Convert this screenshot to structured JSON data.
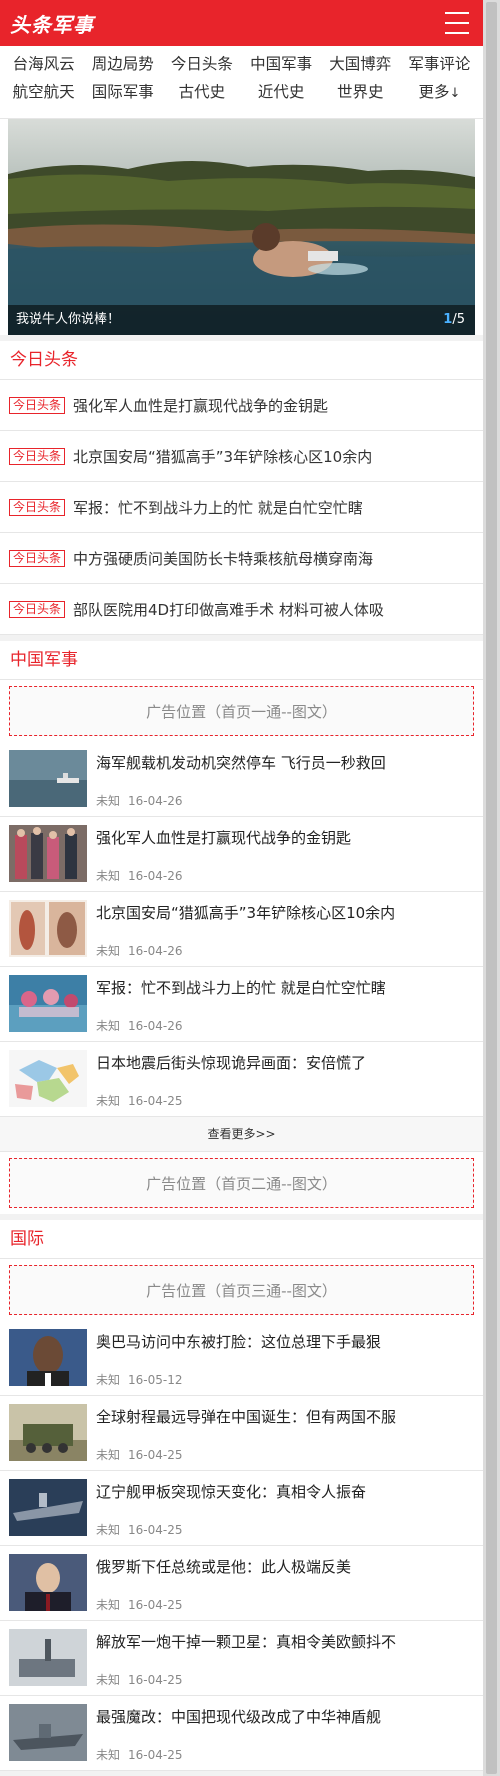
{
  "header": {
    "logo": "头条军事"
  },
  "nav": [
    {
      "label": "台海风云"
    },
    {
      "label": "周边局势"
    },
    {
      "label": "今日头条"
    },
    {
      "label": "中国军事"
    },
    {
      "label": "大国博弈"
    },
    {
      "label": "军事评论"
    },
    {
      "label": "航空航天"
    },
    {
      "label": "国际军事"
    },
    {
      "label": "古代史"
    },
    {
      "label": "近代史"
    },
    {
      "label": "世界史"
    },
    {
      "label": "更多",
      "icon": "down-arrow"
    }
  ],
  "slider": {
    "caption": "我说牛人你说棒！",
    "current": "1",
    "total": "/5"
  },
  "headlines": {
    "title": "今日头条",
    "tag": "今日头条",
    "items": [
      "强化军人血性是打赢现代战争的金钥匙",
      "北京国安局“猎狐高手”3年铲除核心区10余内",
      "军报：忙不到战斗力上的忙 就是白忙空忙瞎",
      "中方强硬质问美国防长卡特乘核航母横穿南海",
      "部队医院用4D打印做高难手术 材料可被人体吸"
    ]
  },
  "china_military": {
    "title": "中国军事",
    "ad_top": "广告位置（首页一通--图文）",
    "items": [
      {
        "title": "海军舰载机发动机突然停车 飞行员一秒救回",
        "source": "未知",
        "date": "16-04-26"
      },
      {
        "title": "强化军人血性是打赢现代战争的金钥匙",
        "source": "未知",
        "date": "16-04-26"
      },
      {
        "title": "北京国安局“猎狐高手”3年铲除核心区10余内",
        "source": "未知",
        "date": "16-04-26"
      },
      {
        "title": "军报：忙不到战斗力上的忙 就是白忙空忙瞎",
        "source": "未知",
        "date": "16-04-26"
      },
      {
        "title": "日本地震后街头惊现诡异画面：安倍慌了",
        "source": "未知",
        "date": "16-04-25"
      }
    ],
    "more": "查看更多>>",
    "ad_bottom": "广告位置（首页二通--图文）"
  },
  "international": {
    "title": "国际",
    "ad_top": "广告位置（首页三通--图文）",
    "items": [
      {
        "title": "奥巴马访问中东被打脸：这位总理下手最狠",
        "source": "未知",
        "date": "16-05-12"
      },
      {
        "title": "全球射程最远导弹在中国诞生：但有两国不服",
        "source": "未知",
        "date": "16-04-25"
      },
      {
        "title": "辽宁舰甲板突现惊天变化：真相令人振奋",
        "source": "未知",
        "date": "16-04-25"
      },
      {
        "title": "俄罗斯下任总统或是他：此人极端反美",
        "source": "未知",
        "date": "16-04-25"
      },
      {
        "title": "解放军一炮干掉一颗卫星：真相令美欧颤抖不",
        "source": "未知",
        "date": "16-04-25"
      },
      {
        "title": "最强魔改：中国把现代级改成了中华神盾舰",
        "source": "未知",
        "date": "16-04-25"
      }
    ]
  },
  "colors": {
    "brand": "#e8242b",
    "counter_accent": "#4ab1ff"
  }
}
